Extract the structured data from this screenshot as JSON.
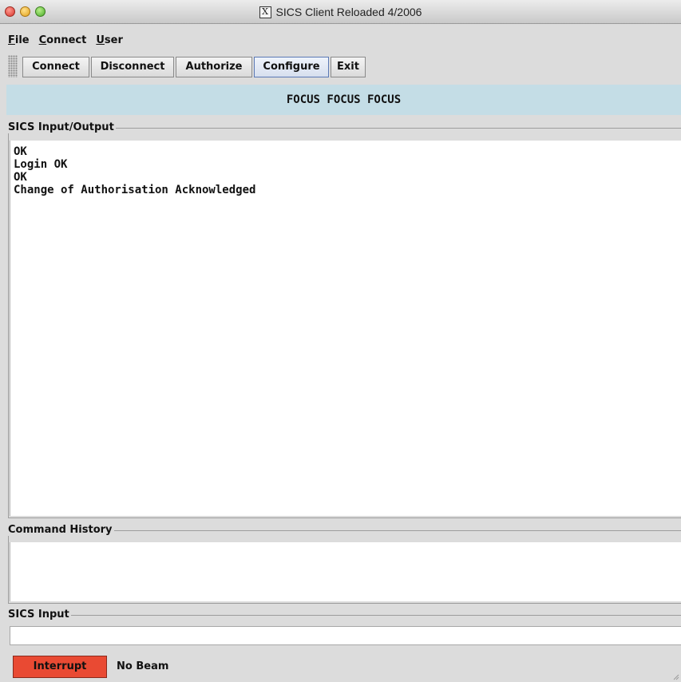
{
  "window": {
    "title": "SICS Client Reloaded 4/2006",
    "app_icon": "x11-icon",
    "app_icon_glyph": "X"
  },
  "menu": {
    "items": [
      {
        "label": "File",
        "mnemonic": "F",
        "rest": "ile"
      },
      {
        "label": "Connect",
        "mnemonic": "C",
        "rest": "onnect"
      },
      {
        "label": "User",
        "mnemonic": "U",
        "rest": "ser"
      }
    ]
  },
  "toolbar": {
    "buttons": [
      {
        "label": "Connect"
      },
      {
        "label": "Disconnect"
      },
      {
        "label": "Authorize"
      },
      {
        "label": "Configure",
        "active": true
      },
      {
        "label": "Exit"
      }
    ]
  },
  "banner": {
    "text": "FOCUS FOCUS FOCUS",
    "color": "#c4dde6"
  },
  "io_panel": {
    "title": "SICS Input/Output",
    "lines": [
      "OK",
      "Login OK",
      "OK",
      "Change of Authorisation Acknowledged"
    ]
  },
  "history_panel": {
    "title": "Command History"
  },
  "input_panel": {
    "title": "SICS Input",
    "value": ""
  },
  "status": {
    "interrupt_label": "Interrupt",
    "interrupt_color": "#e94a33",
    "beam_status": "No Beam"
  }
}
